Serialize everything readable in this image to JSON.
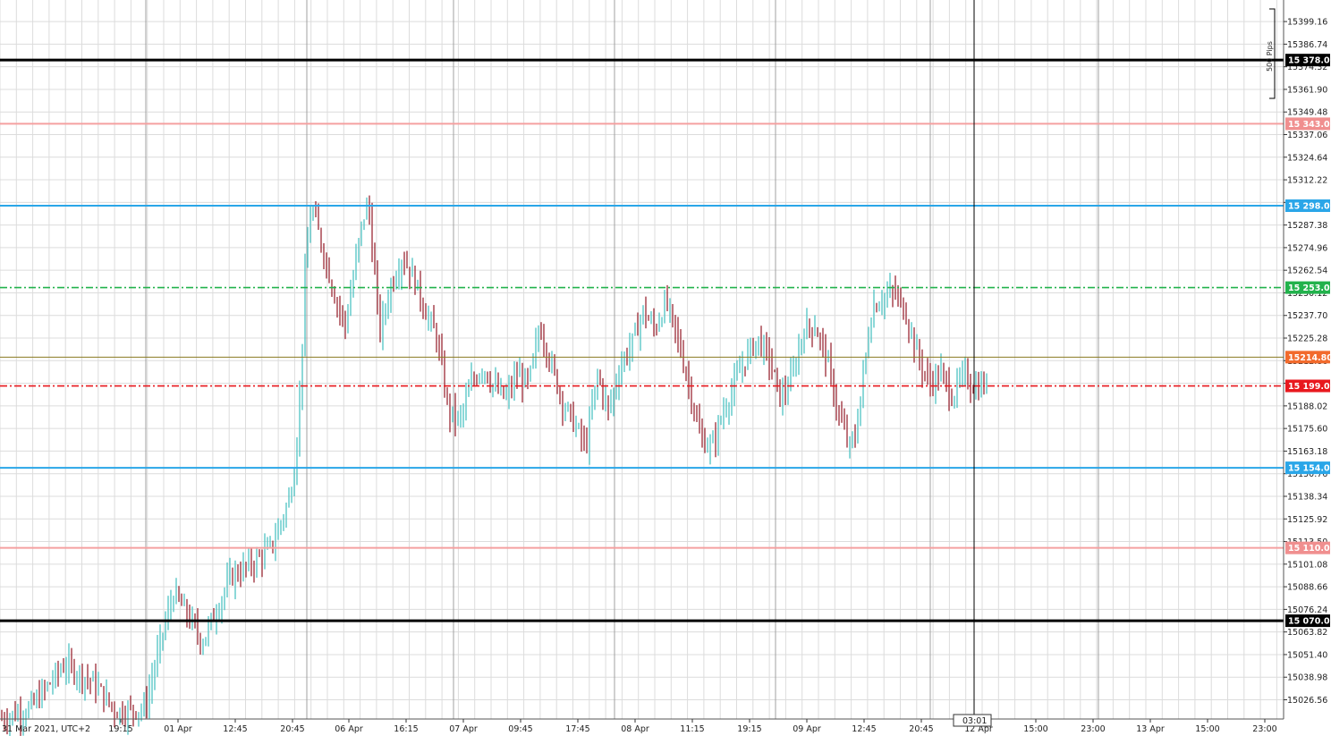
{
  "chart_data": {
    "type": "bar",
    "instrument_timezone_label": "31 Mar 2021, UTC+2",
    "ylim": [
      15016.0,
      15411.0
    ],
    "y_ticks": [
      "15399.16",
      "15386.74",
      "15374.32",
      "15361.90",
      "15349.48",
      "15337.06",
      "15324.64",
      "15312.22",
      "15299.80",
      "15287.38",
      "15274.96",
      "15262.54",
      "15250.12",
      "15237.70",
      "15225.28",
      "15212.86",
      "15200.44",
      "15188.02",
      "15175.60",
      "15163.18",
      "15150.76",
      "15138.34",
      "15125.92",
      "15113.50",
      "15101.08",
      "15088.66",
      "15076.24",
      "15063.82",
      "15051.40",
      "15038.98",
      "15026.56"
    ],
    "x_ticks": [
      "19:15",
      "01 Apr",
      "12:45",
      "20:45",
      "06 Apr",
      "16:15",
      "07 Apr",
      "09:45",
      "17:45",
      "08 Apr",
      "11:15",
      "19:15",
      "09 Apr",
      "12:45",
      "20:45",
      "12 Apr",
      "15:00",
      "23:00",
      "13 Apr",
      "15:00",
      "23:00"
    ],
    "current_time_label": "03:01",
    "pips_label": "500 Pips",
    "current_price": {
      "label": "15214.80",
      "value": 15214.8,
      "color": "#f26a2c"
    },
    "horizontal_levels": [
      {
        "label": "15 378.00",
        "value": 15378.0,
        "color": "#000000",
        "style": "solid",
        "tag_text_color": "#ffffff"
      },
      {
        "label": "15 343.00",
        "value": 15343.0,
        "color": "#f5a0a0",
        "style": "solid",
        "tag_text_color": "#ffffff"
      },
      {
        "label": "15 298.00",
        "value": 15298.0,
        "color": "#2aa6e8",
        "style": "solid",
        "tag_text_color": "#ffffff"
      },
      {
        "label": "15 253.00",
        "value": 15253.0,
        "color": "#22b24c",
        "style": "dashdot",
        "tag_text_color": "#ffffff"
      },
      {
        "label": "15 199.00",
        "value": 15199.0,
        "color": "#e8181e",
        "style": "dashdot",
        "tag_text_color": "#ffffff"
      },
      {
        "label": "15 154.00",
        "value": 15154.0,
        "color": "#2aa6e8",
        "style": "solid",
        "tag_text_color": "#ffffff"
      },
      {
        "label": "15 110.00",
        "value": 15110.0,
        "color": "#f5a0a0",
        "style": "solid",
        "tag_text_color": "#ffffff"
      },
      {
        "label": "15 070.00",
        "value": 15070.0,
        "color": "#000000",
        "style": "solid",
        "tag_text_color": "#ffffff"
      }
    ],
    "up_color": "#4fc3c3",
    "down_color": "#9b2a35",
    "price_path_anchors": [
      [
        0,
        15016
      ],
      [
        5,
        15022
      ],
      [
        11,
        15046
      ],
      [
        16,
        15036
      ],
      [
        20,
        15020
      ],
      [
        25,
        15022
      ],
      [
        28,
        15062
      ],
      [
        30,
        15085
      ],
      [
        33,
        15070
      ],
      [
        35,
        15058
      ],
      [
        38,
        15080
      ],
      [
        40,
        15094
      ],
      [
        44,
        15102
      ],
      [
        47,
        15110
      ],
      [
        48,
        15118
      ],
      [
        50,
        15135
      ],
      [
        51,
        15150
      ],
      [
        52,
        15190
      ],
      [
        53,
        15262
      ],
      [
        54,
        15298
      ],
      [
        56,
        15275
      ],
      [
        58,
        15250
      ],
      [
        60,
        15232
      ],
      [
        63,
        15290
      ],
      [
        64,
        15300
      ],
      [
        66,
        15228
      ],
      [
        68,
        15255
      ],
      [
        70,
        15270
      ],
      [
        72,
        15258
      ],
      [
        74,
        15240
      ],
      [
        76,
        15225
      ],
      [
        78,
        15185
      ],
      [
        80,
        15180
      ],
      [
        82,
        15200
      ],
      [
        84,
        15210
      ],
      [
        86,
        15198
      ],
      [
        88,
        15192
      ],
      [
        90,
        15205
      ],
      [
        92,
        15200
      ],
      [
        94,
        15232
      ],
      [
        96,
        15210
      ],
      [
        98,
        15190
      ],
      [
        100,
        15178
      ],
      [
        102,
        15165
      ],
      [
        104,
        15205
      ],
      [
        106,
        15185
      ],
      [
        108,
        15210
      ],
      [
        110,
        15222
      ],
      [
        112,
        15240
      ],
      [
        114,
        15230
      ],
      [
        116,
        15245
      ],
      [
        118,
        15225
      ],
      [
        120,
        15200
      ],
      [
        122,
        15170
      ],
      [
        124,
        15165
      ],
      [
        126,
        15185
      ],
      [
        128,
        15200
      ],
      [
        130,
        15215
      ],
      [
        132,
        15225
      ],
      [
        134,
        15214
      ],
      [
        136,
        15192
      ],
      [
        138,
        15203
      ],
      [
        140,
        15230
      ],
      [
        142,
        15232
      ],
      [
        144,
        15215
      ],
      [
        146,
        15185
      ],
      [
        148,
        15165
      ],
      [
        149,
        15170
      ],
      [
        151,
        15218
      ],
      [
        152,
        15242
      ],
      [
        154,
        15248
      ],
      [
        156,
        15250
      ],
      [
        158,
        15238
      ],
      [
        160,
        15215
      ],
      [
        162,
        15200
      ],
      [
        164,
        15206
      ],
      [
        166,
        15193
      ],
      [
        168,
        15205
      ],
      [
        170,
        15198
      ],
      [
        172,
        15200
      ]
    ]
  }
}
